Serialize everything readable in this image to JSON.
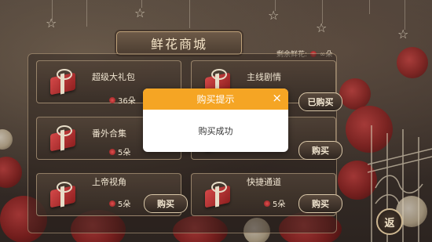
{
  "title": "鲜花商城",
  "remaining": {
    "label": "剩余鲜花:",
    "value": "∞朵"
  },
  "items": [
    {
      "name": "超级大礼包",
      "price": "36朵",
      "button": ""
    },
    {
      "name": "主线剧情",
      "price": "",
      "button": "已购买"
    },
    {
      "name": "番外合集",
      "price": "5朵",
      "button": ""
    },
    {
      "name": "",
      "price": "",
      "button": "购买"
    },
    {
      "name": "上帝视角",
      "price": "5朵",
      "button": "购买"
    },
    {
      "name": "快捷通道",
      "price": "5朵",
      "button": "购买"
    }
  ],
  "back_button": "返",
  "dialog": {
    "title": "购买提示",
    "close": "×",
    "message": "购买成功"
  },
  "colors": {
    "dialog_header": "#f5a524",
    "dialog_body": "#ffffff",
    "accent_gold": "#bfa27a"
  }
}
